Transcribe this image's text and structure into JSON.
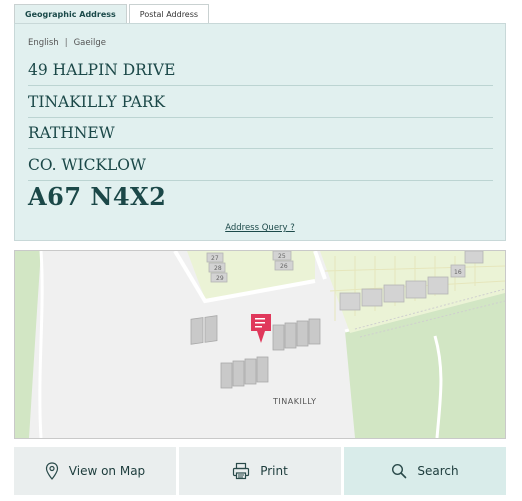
{
  "tabs": [
    {
      "label": "Geographic Address",
      "active": true
    },
    {
      "label": "Postal Address",
      "active": false
    }
  ],
  "language": {
    "english": "English",
    "separator": "|",
    "irish": "Gaeilge"
  },
  "address": {
    "line1": "49 HALPIN DRIVE",
    "line2": "TINAKILLY PARK",
    "line3": "RATHNEW",
    "line4": "CO. WICKLOW"
  },
  "eircode": "A67 N4X2",
  "address_query_link": "Address Query ?",
  "map": {
    "area_label": "TINAKILLY",
    "house_numbers": [
      "27",
      "28",
      "29",
      "25",
      "26",
      "16"
    ],
    "marker_color": "#e0385b"
  },
  "buttons": {
    "view_on_map": "View on Map",
    "print": "Print",
    "search": "Search"
  },
  "colors": {
    "panel_bg": "#e1f0ef",
    "text_primary": "#1b4848",
    "map_green": "#d2e6c4"
  }
}
